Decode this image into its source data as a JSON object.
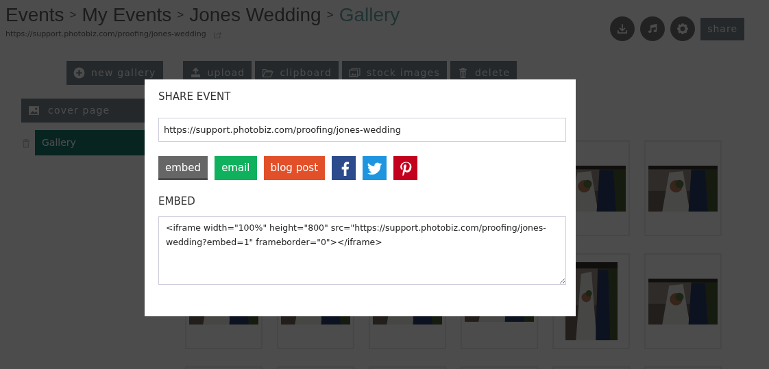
{
  "breadcrumb": [
    {
      "label": "Events",
      "current": false
    },
    {
      "label": "My Events",
      "current": false
    },
    {
      "label": "Jones Wedding",
      "current": false
    },
    {
      "label": "Gallery",
      "current": true
    }
  ],
  "breadcrumb_separator": ">",
  "event_url": "https://support.photobiz.com/proofing/jones-wedding",
  "header_actions": [
    {
      "kind": "download"
    },
    {
      "kind": "music"
    },
    {
      "kind": "settings"
    },
    {
      "kind": "text",
      "label": "share"
    }
  ],
  "new_gallery_button": "new gallery",
  "toolbar": [
    {
      "kind": "upload",
      "label": "upload"
    },
    {
      "kind": "clipboard",
      "label": "clipboard"
    },
    {
      "kind": "stock",
      "label": "stock images"
    },
    {
      "kind": "delete",
      "label": "delete"
    }
  ],
  "sidebar": {
    "cover_page": "cover page",
    "galleries": [
      {
        "label": "Gallery",
        "selected": true
      }
    ]
  },
  "gallery": {
    "rows": [
      [
        {
          "kind": "covered"
        },
        {
          "kind": "covered"
        },
        {
          "kind": "covered"
        },
        {
          "kind": "covered"
        },
        {
          "kind": "landscape"
        },
        {
          "kind": "landscape"
        }
      ],
      [
        {
          "kind": "landscape"
        },
        {
          "kind": "landscape"
        },
        {
          "kind": "landscape"
        },
        {
          "kind": "wide"
        },
        {
          "kind": "portrait"
        },
        {
          "kind": "landscape"
        }
      ],
      [
        {
          "kind": "empty"
        },
        {
          "kind": "empty"
        },
        {
          "kind": "empty"
        },
        {
          "kind": "empty"
        },
        {
          "kind": "empty"
        },
        {
          "kind": "empty"
        }
      ]
    ]
  },
  "modal": {
    "title": "SHARE EVENT",
    "url_value": "https://support.photobiz.com/proofing/jones-wedding",
    "share_buttons": [
      {
        "kind": "text",
        "label": "embed",
        "color": "#666666",
        "selected": true
      },
      {
        "kind": "text",
        "label": "email",
        "color": "#0fb15d",
        "selected": false
      },
      {
        "kind": "text",
        "label": "blog post",
        "color": "#e2502a",
        "selected": false
      },
      {
        "kind": "facebook",
        "color": "#2b4b8c",
        "selected": false
      },
      {
        "kind": "twitter",
        "color": "#1f95e0",
        "selected": false
      },
      {
        "kind": "pinterest",
        "color": "#c3001d",
        "selected": false
      }
    ],
    "embed_label": "EMBED",
    "embed_code": "<iframe width=\"100%\" height=\"800\" src=\"https://support.photobiz.com/proofing/jones-wedding?embed=1\" frameborder=\"0\"></iframe>"
  }
}
